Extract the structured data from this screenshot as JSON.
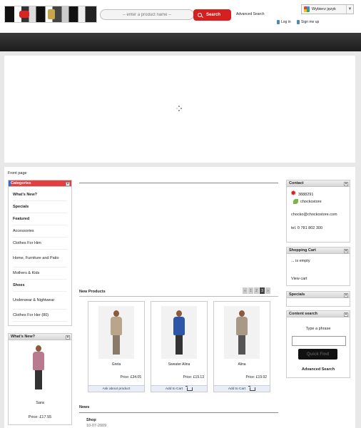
{
  "header": {
    "search_placeholder": "-- enter a product name --",
    "search_button": "Search",
    "advanced_search": "Advanced Search",
    "language": "Wybierz język",
    "login": "Log in",
    "signup": "Sign me up"
  },
  "breadcrumb": "Front page",
  "categories": {
    "title": "Categories",
    "items": [
      "What's New?",
      "Specials",
      "Featured",
      "Accessories",
      "Clothes For Him",
      "Home, Furniture and Patio",
      "Mothers & Kids",
      "Shoes",
      "Underwear & Nightwear",
      "Clothes For Her (80)"
    ]
  },
  "whats_new": {
    "title": "What's New?",
    "product_name": "Sara",
    "price": "Price: £17.55"
  },
  "new_products": {
    "title": "New Products",
    "pager": [
      "«",
      "1",
      "2",
      "3",
      "»"
    ],
    "pager_current": "3",
    "items": [
      {
        "name": "Greta",
        "price": "Price: £34.05",
        "action": "Ask about product",
        "body_color": "#b9a48c"
      },
      {
        "name": "Sweater Alina",
        "price": "Price: £19.13",
        "action": "Add to Cart",
        "body_color": "#2f55a8"
      },
      {
        "name": "Alina",
        "price": "Price: £19.92",
        "action": "Add to Cart",
        "body_color": "#a89888"
      }
    ]
  },
  "news": {
    "title": "News",
    "item_title": "Shop",
    "item_date": "10-07-2009"
  },
  "contact": {
    "title": "Contact",
    "phone": "3888291",
    "skype": "chockostore",
    "email": "chocko@chockostore.com",
    "tel": "tel. 0 781 802 300"
  },
  "cart": {
    "title": "Shopping Cart",
    "status": "... is empty",
    "view": "View cart"
  },
  "specials": {
    "title": "Specials"
  },
  "content_search": {
    "title": "Content search",
    "label": "Type a phrase",
    "button": "Quick Find",
    "advanced": "Advanced Search"
  },
  "colors": {
    "accent": "#d61f1f",
    "navbar": "#2a2a2a"
  }
}
